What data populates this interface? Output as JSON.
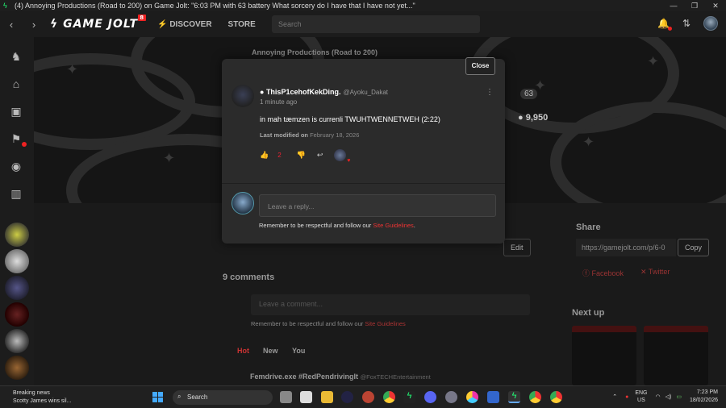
{
  "window": {
    "title": "(4) Annoying Productions (Road to 200) on Game Jolt: \"6:03 PM with 63 battery What sorcery do I have that I have not yet...\"",
    "controls": [
      "—",
      "❐",
      "✕"
    ]
  },
  "nav": {
    "logo": "GAME JOLT",
    "logo_badge": "8",
    "discover": "DISCOVER",
    "store": "STORE",
    "search_placeholder": "Search"
  },
  "background": {
    "post_author": "Annoying Productions (Road to 200)",
    "level": "63",
    "coins": "9,950",
    "edit": "Edit",
    "comments_heading": "9 comments",
    "leave_comment": "Leave a comment...",
    "remember": "Remember to be respectful and follow our",
    "site_guidelines": "Site Guidelines",
    "tabs": [
      "Hot",
      "New",
      "You"
    ],
    "share": "Share",
    "share_url": "https://gamejolt.com/p/6-0",
    "copy": "Copy",
    "facebook": "Facebook",
    "twitter": "Twitter",
    "next_up": "Next up",
    "bottom_post_title": "Femdrive.exe #RedPendrivingIt",
    "bottom_post_handle": "@FoxTECHEntertainment"
  },
  "modal": {
    "close": "Close",
    "username": "ThisP1cehofKekDing.",
    "handle": "@Ayoku_Dakat",
    "time": "1 minute ago",
    "comment": "in mah tæmzen is currenli TWUHTWENNETWEH (2:22)",
    "modified_label": "Last modified on",
    "modified_date": "February 18, 2026",
    "like_count": "2",
    "reply_placeholder": "Leave a reply...",
    "remember": "Remember to be respectful and follow our",
    "site_guidelines": "Site Guidelines",
    "period": "."
  },
  "taskbar": {
    "news_title": "Breaking news",
    "news_sub": "Scotty James wins sil...",
    "search": "Search",
    "lang1": "ENG",
    "lang2": "US",
    "time": "7:23 PM",
    "date": "18/02/2026"
  }
}
